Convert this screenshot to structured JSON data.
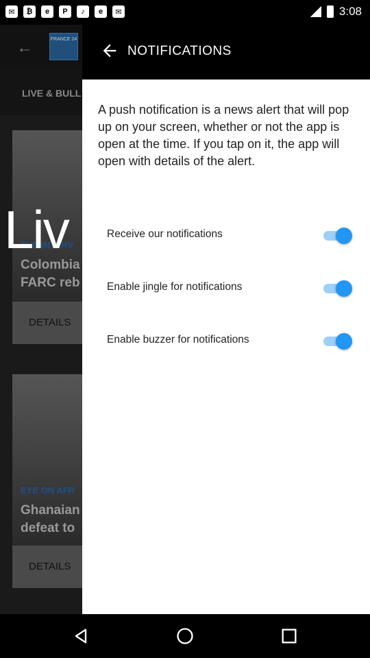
{
  "status_bar": {
    "time": "3:08",
    "notification_icons": [
      "gmail-icon",
      "bitcoin-icon",
      "espn-icon",
      "pinterest-icon",
      "sound-icon",
      "esc-icon",
      "gmail-icon"
    ]
  },
  "background_app": {
    "tab_label": "LIVE & BULL",
    "logo_text": "FRANCE 24",
    "card1": {
      "tag": "THE INTERV",
      "title": "Colombia FARC reb",
      "button": "DETAILS"
    },
    "card2": {
      "tag": "EYE ON AFR",
      "title": "Ghanaian defeat to",
      "button": "DETAILS"
    },
    "live_overlay": "Liv"
  },
  "header": {
    "title": "NOTIFICATIONS"
  },
  "intro_text": "A push notification is a news alert that will pop up on your screen, whether or not the app is open at the time. If you tap on it, the app will open with details of the alert.",
  "settings": [
    {
      "label": "Receive our notifications",
      "enabled": true
    },
    {
      "label": "Enable jingle for notifications",
      "enabled": true
    },
    {
      "label": "Enable buzzer for notifications",
      "enabled": true
    }
  ],
  "colors": {
    "accent": "#2196f3",
    "track": "#9ecff7",
    "panel": "#ffffff",
    "header": "#000000"
  }
}
